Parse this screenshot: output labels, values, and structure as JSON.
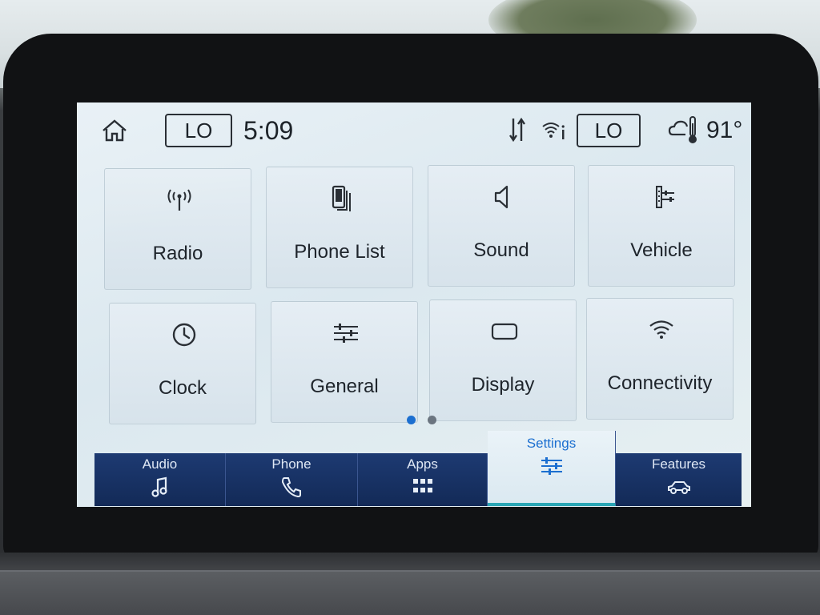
{
  "status_bar": {
    "climate_left": "LO",
    "time": "5:09",
    "climate_right": "LO",
    "temperature": "91°",
    "icons": [
      "home-icon",
      "signal-sync-icon",
      "wifi-info-icon",
      "weather-cloudy-thermometer-icon"
    ]
  },
  "grid": {
    "tiles": [
      {
        "label": "Radio",
        "icon": "radio-antenna-icon"
      },
      {
        "label": "Phone List",
        "icon": "phone-list-icon"
      },
      {
        "label": "Sound",
        "icon": "speaker-icon"
      },
      {
        "label": "Vehicle",
        "icon": "vehicle-settings-icon"
      },
      {
        "label": "Clock",
        "icon": "clock-icon"
      },
      {
        "label": "General",
        "icon": "sliders-icon"
      },
      {
        "label": "Display",
        "icon": "display-icon"
      },
      {
        "label": "Connectivity",
        "icon": "wifi-icon"
      }
    ],
    "page_indicator": {
      "current": 1,
      "total": 2
    }
  },
  "nav": {
    "items": [
      {
        "label": "Audio",
        "icon": "music-note-icon"
      },
      {
        "label": "Phone",
        "icon": "phone-icon"
      },
      {
        "label": "Apps",
        "icon": "apps-grid-icon"
      },
      {
        "label": "Settings",
        "icon": "settings-sliders-icon",
        "active": true
      },
      {
        "label": "Features",
        "icon": "car-icon"
      }
    ]
  },
  "colors": {
    "accent": "#1c6fd0",
    "nav_bg": "#132a57",
    "screen_bg": "#e3edf3"
  }
}
